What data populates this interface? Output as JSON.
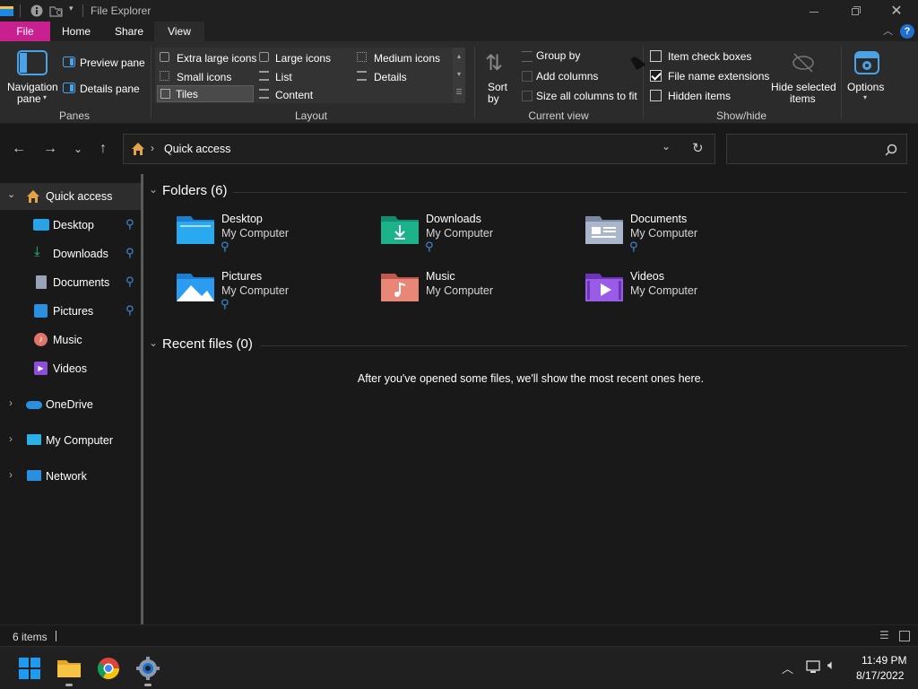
{
  "window": {
    "title": "File Explorer"
  },
  "tabs": [
    {
      "label": "File"
    },
    {
      "label": "Home"
    },
    {
      "label": "Share"
    },
    {
      "label": "View"
    }
  ],
  "ribbon": {
    "panes": {
      "nav_pane": "Navigation",
      "nav_pane2": "pane",
      "preview": "Preview pane",
      "details": "Details pane",
      "group": "Panes"
    },
    "layout": {
      "items": [
        "Extra large icons",
        "Large icons",
        "Medium icons",
        "Small icons",
        "List",
        "Details",
        "Tiles",
        "Content"
      ],
      "group": "Layout"
    },
    "current_view": {
      "sort": "Sort",
      "sort2": "by",
      "group_by": "Group by",
      "add_columns": "Add columns",
      "size_all": "Size all columns to fit",
      "group": "Current view"
    },
    "show_hide": {
      "item_check": "Item check boxes",
      "item_check_checked": false,
      "file_ext": "File name extensions",
      "file_ext_checked": true,
      "hidden": "Hidden items",
      "hidden_checked": false,
      "hide_selected": "Hide selected",
      "hide_selected2": "items",
      "options": "Options",
      "group": "Show/hide"
    }
  },
  "address": {
    "path": "Quick access"
  },
  "sidebar": {
    "items": [
      {
        "label": "Quick access"
      },
      {
        "label": "Desktop"
      },
      {
        "label": "Downloads"
      },
      {
        "label": "Documents"
      },
      {
        "label": "Pictures"
      },
      {
        "label": "Music"
      },
      {
        "label": "Videos"
      },
      {
        "label": "OneDrive"
      },
      {
        "label": "My Computer"
      },
      {
        "label": "Network"
      }
    ]
  },
  "main": {
    "folders_header": "Folders (6)",
    "folders": [
      {
        "name": "Desktop",
        "location": "My Computer"
      },
      {
        "name": "Downloads",
        "location": "My Computer"
      },
      {
        "name": "Documents",
        "location": "My Computer"
      },
      {
        "name": "Pictures",
        "location": "My Computer"
      },
      {
        "name": "Music",
        "location": "My Computer"
      },
      {
        "name": "Videos",
        "location": "My Computer"
      }
    ],
    "recent_header": "Recent files (0)",
    "recent_empty": "After you've opened some files, we'll show the most recent ones here."
  },
  "status": {
    "items": "6 items"
  },
  "taskbar": {
    "time": "11:49 PM",
    "date": "8/17/2022"
  },
  "colors": {
    "file_tab": "#c8208f",
    "accent": "#0078d4",
    "help": "#1f6fd0"
  }
}
